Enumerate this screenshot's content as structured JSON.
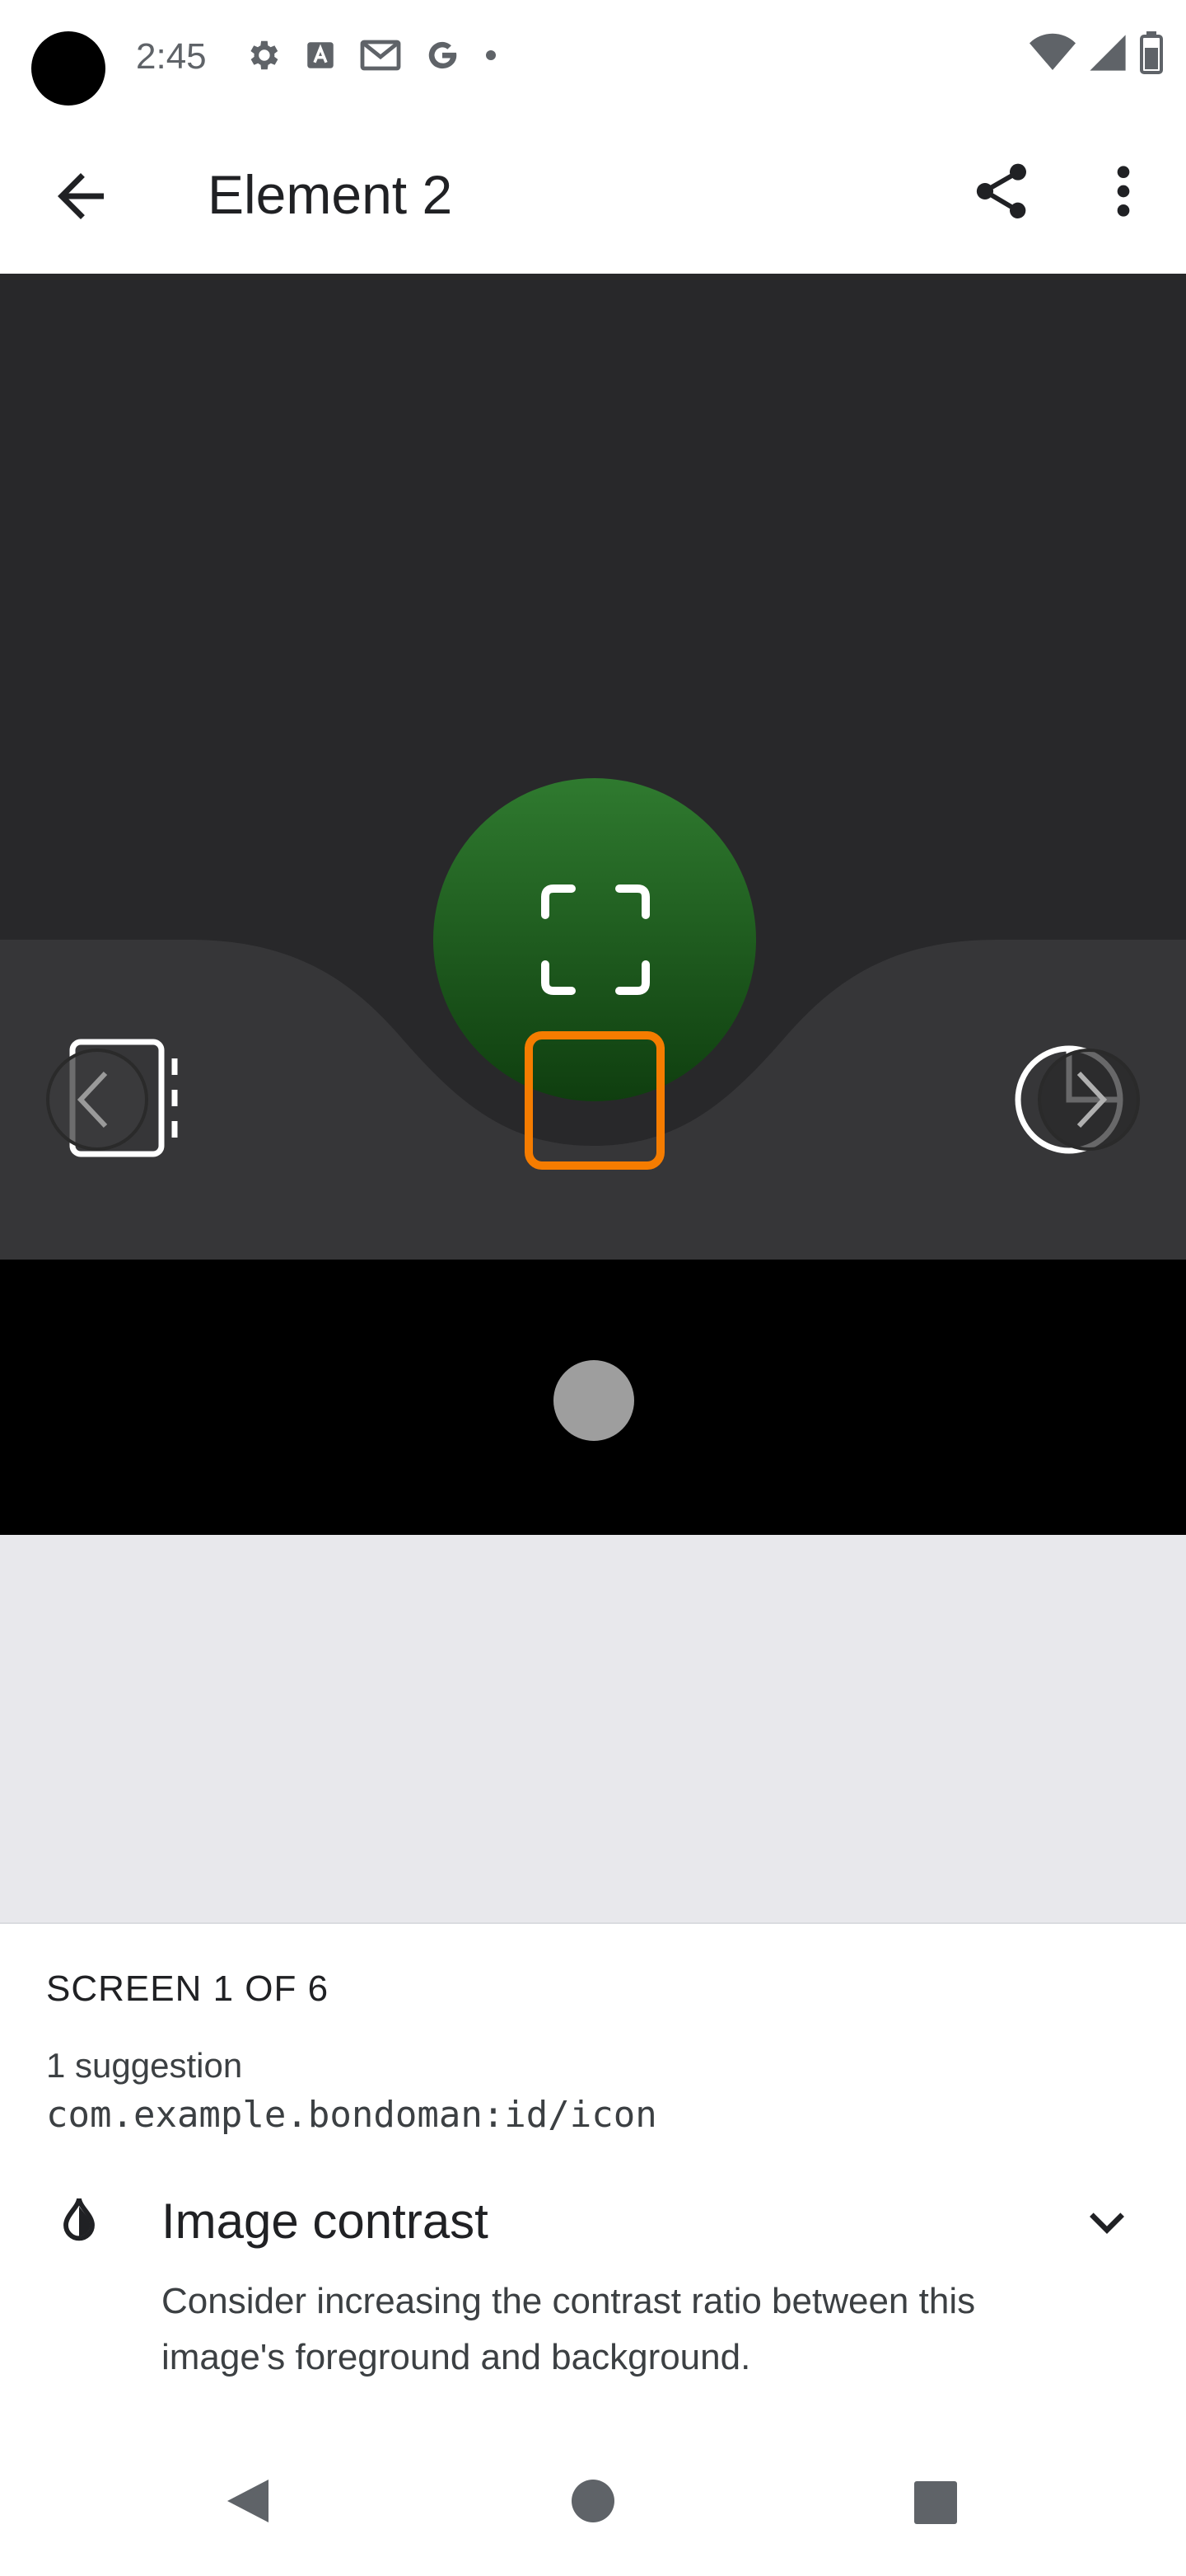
{
  "status_bar": {
    "time": "2:45",
    "left_icons": [
      "gear-icon",
      "font-a-icon",
      "gmail-icon",
      "google-g-icon",
      "dot-icon"
    ],
    "right_icons": [
      "wifi-icon",
      "signal-icon",
      "battery-icon"
    ]
  },
  "app_bar": {
    "title": "Element 2",
    "back_icon": "arrow-back-icon",
    "share_icon": "share-icon",
    "more_icon": "more-vert-icon"
  },
  "preview": {
    "fab_color": "#1e5b1e",
    "highlight_color": "#f57c00",
    "left_icon": "notes-arrow-icon",
    "right_icon": "pie-arrow-icon"
  },
  "sheet": {
    "screen_counter": "SCREEN 1 OF 6",
    "suggestion_count": "1 suggestion",
    "resource_id": "com.example.bondoman:id/icon",
    "suggestion": {
      "icon": "contrast-icon",
      "title": "Image contrast",
      "description": "Consider increasing the contrast ratio between this image's foreground and background."
    }
  },
  "nav_bar": {
    "buttons": [
      "back-triangle-icon",
      "home-circle-icon",
      "recents-square-icon"
    ]
  }
}
